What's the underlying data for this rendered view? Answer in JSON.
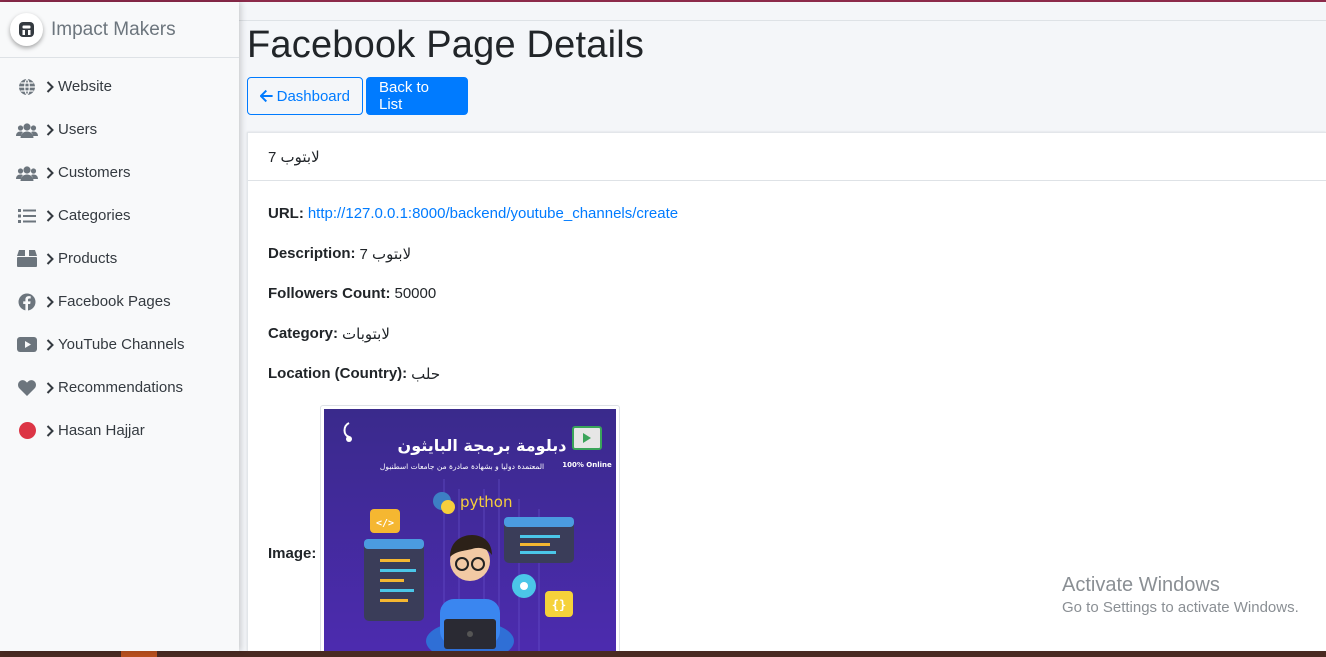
{
  "brand": {
    "name": "Impact Makers"
  },
  "sidebar": {
    "items": [
      {
        "label": "Website",
        "icon": "globe-icon"
      },
      {
        "label": "Users",
        "icon": "users-icon"
      },
      {
        "label": "Customers",
        "icon": "users-icon"
      },
      {
        "label": "Categories",
        "icon": "list-icon"
      },
      {
        "label": "Products",
        "icon": "box-icon"
      },
      {
        "label": "Facebook Pages",
        "icon": "facebook-icon"
      },
      {
        "label": "YouTube Channels",
        "icon": "youtube-icon"
      },
      {
        "label": "Recommendations",
        "icon": "heart-icon"
      },
      {
        "label": "Hasan Hajjar",
        "icon": "user-status-dot"
      }
    ]
  },
  "page": {
    "title": "Facebook Page Details",
    "dashboard_button": "Dashboard",
    "back_button": "Back to List"
  },
  "details": {
    "header": "7 لابتوب",
    "url_label": "URL:",
    "url": "http://127.0.0.1:8000/backend/youtube_channels/create",
    "description_label": "Description:",
    "description": "7 لابتوب",
    "followers_label": "Followers Count:",
    "followers": "50000",
    "category_label": "Category:",
    "category": "لابتوبات",
    "location_label": "Location (Country):",
    "location": "حلب",
    "image_label": "Image:"
  },
  "image_text": {
    "headline": "دبلومة برمجة البايثون",
    "subline": "المعتمدة دوليا و بشهادة صادرة من جامعات اسطنبول",
    "python": "python",
    "online": "100% Online"
  },
  "watermark": {
    "title": "Activate Windows",
    "subtitle": "Go to Settings to activate Windows."
  },
  "colors": {
    "primary": "#007bff",
    "sidebar_bg": "#f8f9fa",
    "page_bg": "#f4f6f9",
    "status_dot": "#dc3545"
  }
}
